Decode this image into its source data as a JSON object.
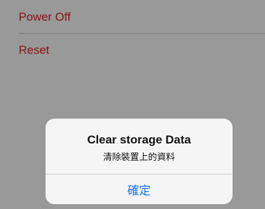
{
  "menu": {
    "items": [
      {
        "label": "Power Off"
      },
      {
        "label": "Reset"
      }
    ],
    "item_color": "#e02020"
  },
  "alert": {
    "title": "Clear storage Data",
    "message": "清除裝置上的資料",
    "confirm_label": "確定",
    "button_color": "#1a73e8"
  }
}
